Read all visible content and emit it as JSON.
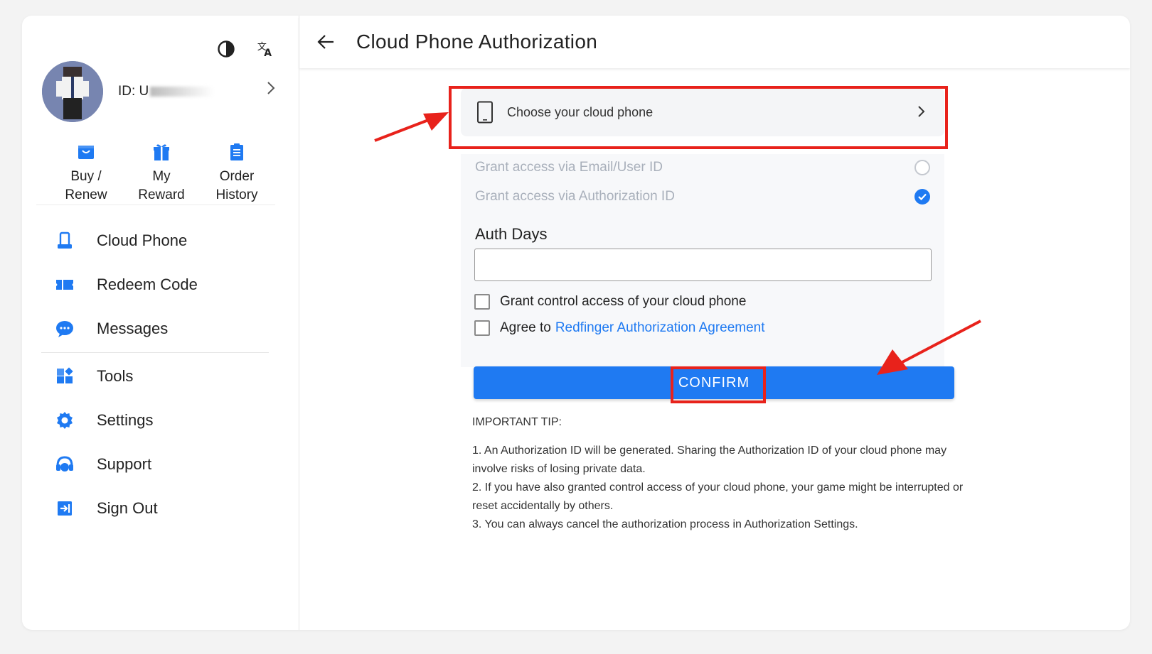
{
  "sidebar": {
    "user_id_label": "ID: U",
    "quick_actions": [
      {
        "label": "Buy /\nRenew",
        "icon": "shopping-bag-icon"
      },
      {
        "label": "My\nReward",
        "icon": "gift-icon"
      },
      {
        "label": "Order\nHistory",
        "icon": "clipboard-list-icon"
      }
    ],
    "menu": [
      {
        "label": "Cloud Phone",
        "icon": "phone-icon"
      },
      {
        "label": "Redeem Code",
        "icon": "ticket-icon"
      },
      {
        "label": "Messages",
        "icon": "chat-bubble-icon"
      },
      {
        "label": "Tools",
        "icon": "tools-grid-icon"
      },
      {
        "label": "Settings",
        "icon": "gear-icon"
      },
      {
        "label": "Support",
        "icon": "headset-icon"
      },
      {
        "label": "Sign Out",
        "icon": "sign-out-icon"
      }
    ]
  },
  "header": {
    "title": "Cloud Phone Authorization"
  },
  "form": {
    "choose_phone_label": "Choose your cloud phone",
    "grant_email_label": "Grant access via Email/User ID",
    "grant_auth_id_label": "Grant access via Authorization ID",
    "grant_selected": "Grant access via Authorization ID",
    "auth_days_label": "Auth Days",
    "auth_days_value": "",
    "control_access_label": "Grant control access of your cloud phone",
    "agree_prefix": "Agree to",
    "agreement_link": "Redfinger Authorization Agreement",
    "confirm_label": "CONFIRM"
  },
  "tips": {
    "title": "IMPORTANT TIP:",
    "lines": [
      "1. An Authorization ID will be generated. Sharing the Authorization ID of your cloud phone may involve risks of losing private data.",
      "2. If you have also granted control access of your cloud phone, your game might be interrupted or reset accidentally by others.",
      "3. You can always cancel the authorization process in Authorization Settings."
    ]
  },
  "colors": {
    "accent": "#1f7af2",
    "annotation": "#e8221b"
  }
}
